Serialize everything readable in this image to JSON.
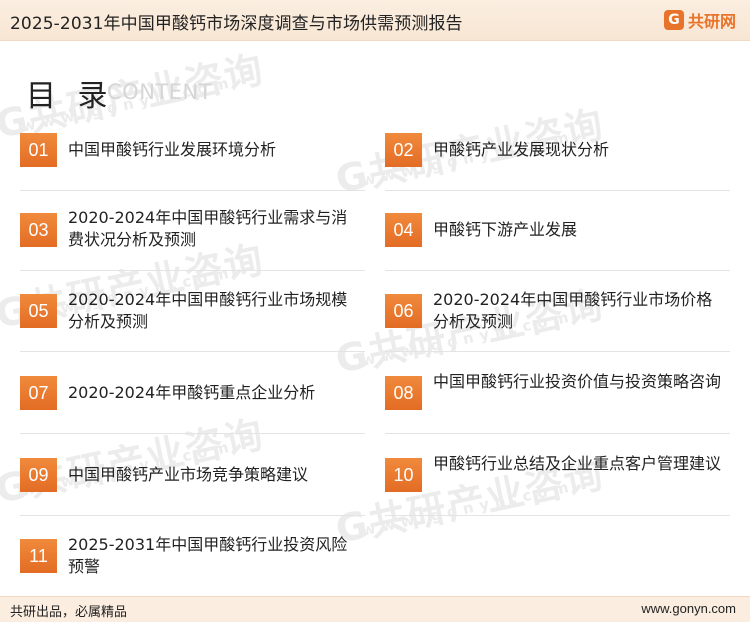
{
  "header": {
    "title": "2025-2031年中国甲酸钙市场深度调查与市场供需预测报告",
    "brand_name": "共研网",
    "brand_mark": "G"
  },
  "toc": {
    "heading": "目 录",
    "subheading": "CONTENT",
    "items": [
      {
        "num": "01",
        "label": "中国甲酸钙行业发展环境分析"
      },
      {
        "num": "02",
        "label": "甲酸钙产业发展现状分析"
      },
      {
        "num": "03",
        "label": "2020-2024年中国甲酸钙行业需求与消费状况分析及预测"
      },
      {
        "num": "04",
        "label": "甲酸钙下游产业发展"
      },
      {
        "num": "05",
        "label": "2020-2024年中国甲酸钙行业市场规模分析及预测"
      },
      {
        "num": "06",
        "label": "2020-2024年中国甲酸钙行业市场价格分析及预测"
      },
      {
        "num": "07",
        "label": "2020-2024年甲酸钙重点企业分析"
      },
      {
        "num": "08",
        "label": "中国甲酸钙行业投资价值与投资策略咨询"
      },
      {
        "num": "09",
        "label": "中国甲酸钙产业市场竞争策略建议"
      },
      {
        "num": "10",
        "label": "甲酸钙行业总结及企业重点客户管理建议"
      },
      {
        "num": "11",
        "label": "2025-2031年中国甲酸钙行业投资风险预警"
      }
    ]
  },
  "watermark": {
    "text": "G共研产业咨询",
    "url": "www.gonyn.com"
  },
  "footer": {
    "slogan": "共研出品，必属精品",
    "site": "www.gonyn.com"
  }
}
